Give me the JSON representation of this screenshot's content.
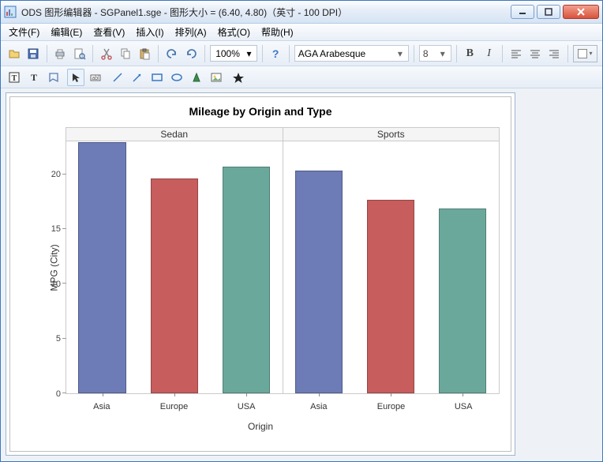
{
  "window": {
    "title": "ODS 图形编辑器 - SGPanel1.sge - 图形大小 = (6.40, 4.80)（英寸 - 100 DPI）"
  },
  "menubar": [
    "文件(F)",
    "编辑(E)",
    "查看(V)",
    "插入(I)",
    "排列(A)",
    "格式(O)",
    "帮助(H)"
  ],
  "toolbar": {
    "zoom": "100%",
    "font_name": "AGA Arabesque",
    "font_size": "8"
  },
  "chart_data": {
    "type": "bar",
    "title": "Mileage by Origin and Type",
    "xlabel": "Origin",
    "ylabel": "MPG (City)",
    "ylim": [
      0,
      23
    ],
    "yticks": [
      0,
      5,
      10,
      15,
      20
    ],
    "categories": [
      "Asia",
      "Europe",
      "USA"
    ],
    "panels": [
      "Sedan",
      "Sports"
    ],
    "series_colors": [
      "#6d7bb6",
      "#c75d5d",
      "#6ba89c"
    ],
    "data": {
      "Sedan": {
        "Asia": 22.9,
        "Europe": 19.6,
        "USA": 20.7
      },
      "Sports": {
        "Asia": 20.3,
        "Europe": 17.7,
        "USA": 16.9
      }
    }
  }
}
